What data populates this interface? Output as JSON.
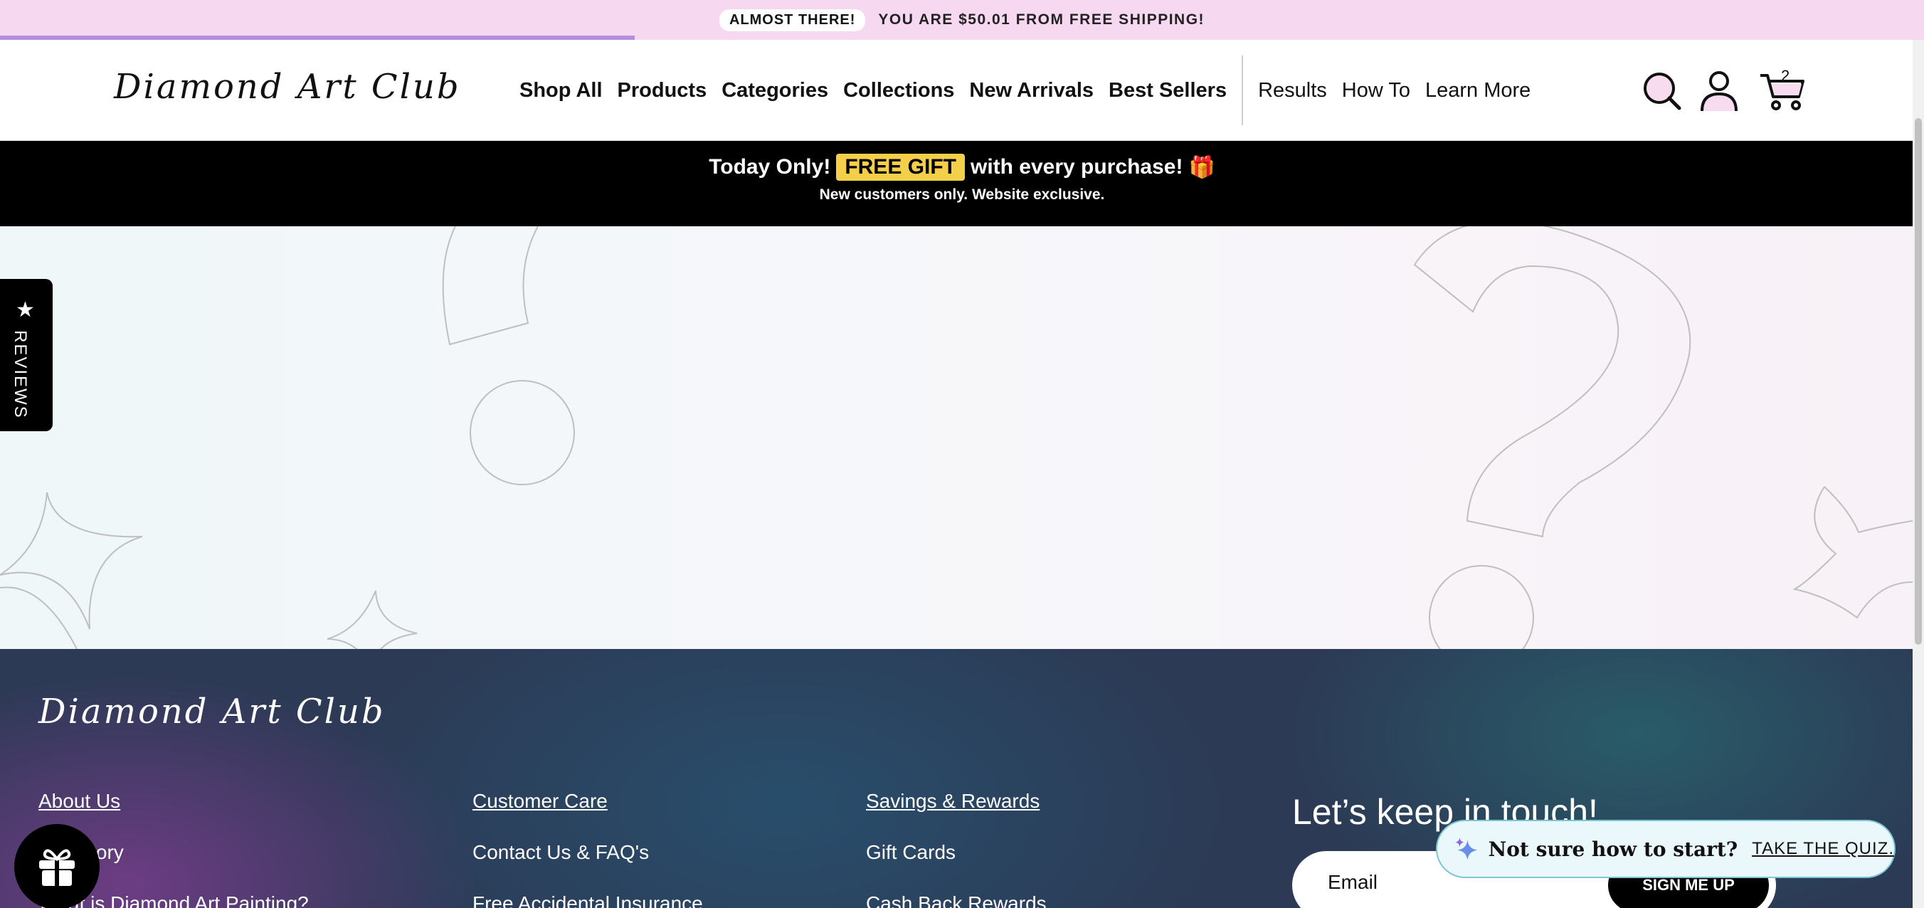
{
  "shipping_bar": {
    "badge": "ALMOST THERE!",
    "message": "YOU ARE $50.01 FROM FREE SHIPPING!",
    "progress_percent": 33,
    "progress_color": "#b48fe0",
    "background": "#f6d8f1"
  },
  "header": {
    "logo": "Diamond Art Club",
    "nav_primary": [
      "Shop All",
      "Products",
      "Categories",
      "Collections",
      "New Arrivals",
      "Best Sellers"
    ],
    "nav_secondary": [
      "Results",
      "How To",
      "Learn More"
    ],
    "icons": [
      "search-icon",
      "account-icon",
      "cart-icon"
    ],
    "cart_count": "2"
  },
  "promo": {
    "lead": "Today Only!",
    "badge": "FREE GIFT",
    "tail": "with every purchase!",
    "gift_emoji": "🎁",
    "subtext": "New customers only. Website exclusive.",
    "badge_color": "#f4d04a"
  },
  "reviews_tab": {
    "label": "REVIEWS",
    "icon": "star-icon"
  },
  "footer": {
    "logo": "Diamond Art Club",
    "col1": [
      "About Us",
      "Our Story",
      "What is Diamond Art Painting?"
    ],
    "col2": [
      "Customer Care",
      "Contact Us & FAQ's",
      "Free Accidental Insurance"
    ],
    "col3": [
      "Savings & Rewards",
      "Gift Cards",
      "Cash Back Rewards"
    ],
    "newsletter": {
      "title": "Let’s keep in touch!",
      "placeholder": "Email",
      "button": "SIGN ME UP"
    }
  },
  "gift_button": {
    "icon": "gift-icon"
  },
  "quiz": {
    "icon": "sparkle-icon",
    "prompt": "Not sure how to start?",
    "link": "TAKE THE QUIZ."
  }
}
